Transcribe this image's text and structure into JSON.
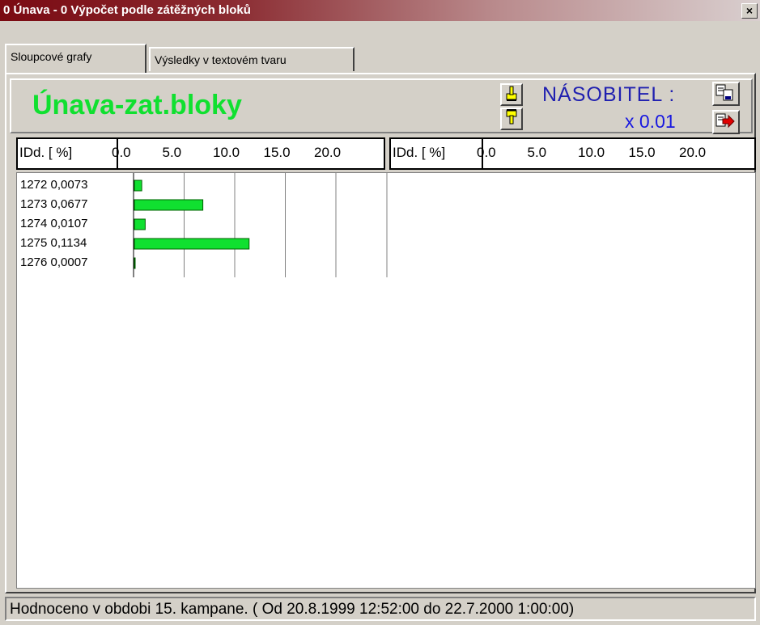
{
  "window": {
    "title": "0 Únava - 0 Výpočet podle zátěžných bloků",
    "close_label": "×"
  },
  "tabs": [
    {
      "label": "Sloupcové grafy",
      "active": true
    },
    {
      "label": "Výsledky v textovém tvaru",
      "active": false
    }
  ],
  "header": {
    "title": "Únava-zat.bloky",
    "multiplier_label": "NÁSOBITEL :",
    "multiplier_value": "x 0.01",
    "icons": [
      "hand-up-icon",
      "hand-down-icon",
      "copy-icon",
      "export-icon"
    ]
  },
  "axis": {
    "label": "IDd. [ %]",
    "ticks": [
      "0.0",
      "5.0",
      "10.0",
      "15.0",
      "20.0"
    ]
  },
  "chart_data": {
    "type": "bar",
    "orientation": "horizontal",
    "categories": [
      "1272",
      "1273",
      "1274",
      "1275",
      "1276"
    ],
    "value_labels": [
      "0,0073",
      "0,0677",
      "0,0107",
      "0,1134",
      "0,0007"
    ],
    "values": [
      0.73,
      6.77,
      1.07,
      11.34,
      0.07
    ],
    "xlabel": "IDd. [ %]",
    "xlim": [
      0,
      25
    ],
    "x_ticks": [
      0,
      5,
      10,
      15,
      20
    ],
    "bar_color": "#10e030",
    "grid": true
  },
  "colors": {
    "title_green": "#10e030",
    "multiplier_blue": "#1818e0",
    "titlebar": "#7a0a12"
  },
  "status": {
    "text": "Hodnoceno v obdobi 15. kampane. ( Od 20.8.1999 12:52:00 do 22.7.2000 1:00:00)"
  }
}
